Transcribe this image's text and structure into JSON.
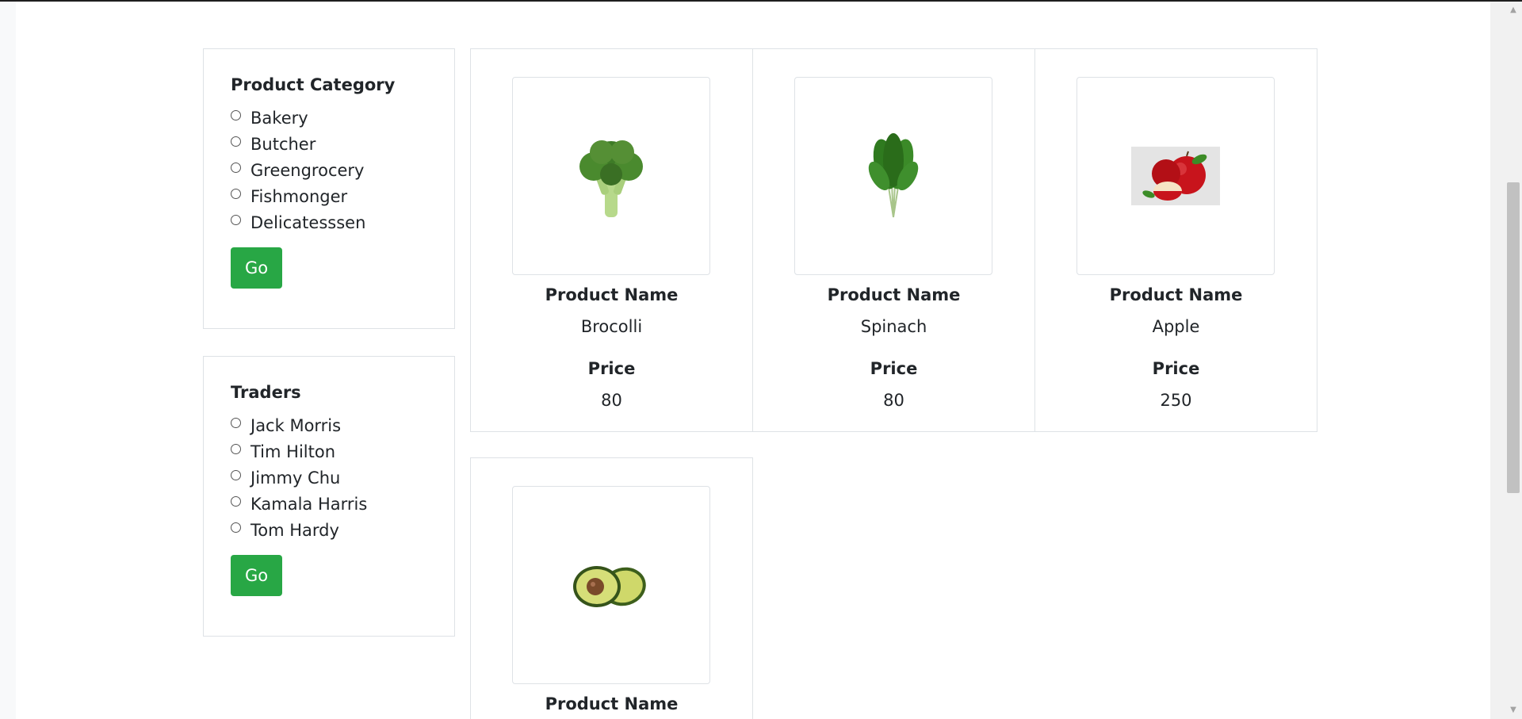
{
  "category_filter": {
    "title": "Product Category",
    "options": [
      "Bakery",
      "Butcher",
      "Greengrocery",
      "Fishmonger",
      "Delicatesssen"
    ],
    "button_label": "Go"
  },
  "traders_filter": {
    "title": "Traders",
    "options": [
      "Jack Morris",
      "Tim Hilton",
      "Jimmy Chu",
      "Kamala Harris",
      "Tom Hardy"
    ],
    "button_label": "Go"
  },
  "products": [
    {
      "name_label": "Product Name",
      "name": "Brocolli",
      "price_label": "Price",
      "price": "80",
      "image_icon": "broccoli-icon"
    },
    {
      "name_label": "Product Name",
      "name": "Spinach",
      "price_label": "Price",
      "price": "80",
      "image_icon": "spinach-icon"
    },
    {
      "name_label": "Product Name",
      "name": "Apple",
      "price_label": "Price",
      "price": "250",
      "image_icon": "apple-icon"
    },
    {
      "name_label": "Product Name",
      "image_icon": "avocado-icon"
    }
  ],
  "colors": {
    "go_button": "#28a745",
    "border": "#dee2e6"
  }
}
